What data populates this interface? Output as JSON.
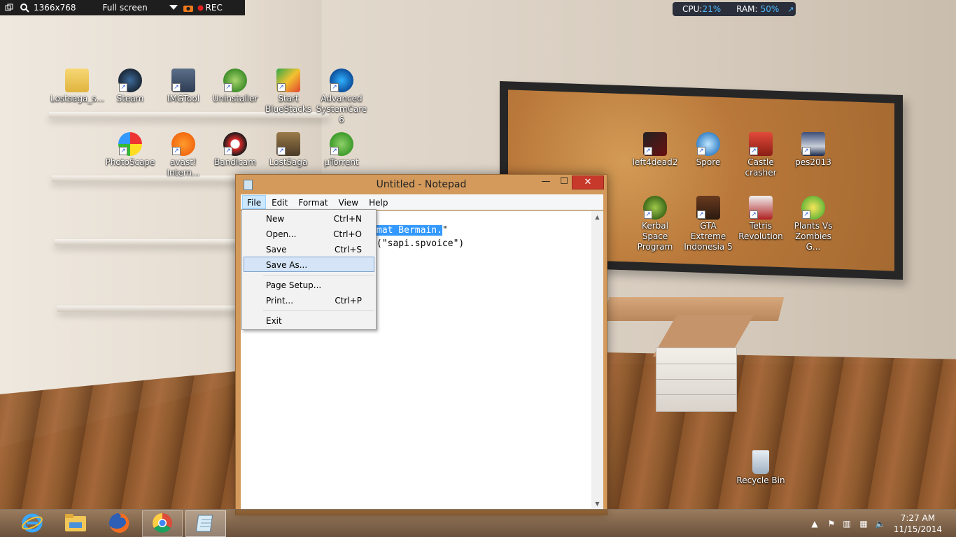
{
  "recorder": {
    "resolution": "1366x768",
    "mode": "Full screen",
    "rec_label": "REC"
  },
  "system_meter": {
    "cpu_label": "CPU:",
    "cpu_value": "21%",
    "ram_label": "RAM:",
    "ram_value": "50%"
  },
  "desktop_icons": [
    {
      "line1": "Lostsaga_s...",
      "line2": "",
      "icon": "folder-icon"
    },
    {
      "line1": "Steam",
      "line2": "",
      "icon": "steam-icon"
    },
    {
      "line1": "IMGTool",
      "line2": "",
      "icon": "imgtool-icon"
    },
    {
      "line1": "Uninstaller",
      "line2": "",
      "icon": "uninstaller-icon"
    },
    {
      "line1": "Start",
      "line2": "BlueStacks",
      "icon": "bluestacks-icon"
    },
    {
      "line1": "Advanced",
      "line2": "SystemCare 6",
      "icon": "systemcare-icon"
    },
    {
      "line1": "PhotoScape",
      "line2": "",
      "icon": "photoscape-icon"
    },
    {
      "line1": "avast!",
      "line2": "Intern...",
      "icon": "avast-icon"
    },
    {
      "line1": "Bandicam",
      "line2": "",
      "icon": "bandicam-icon"
    },
    {
      "line1": "LostSaga",
      "line2": "",
      "icon": "lostsaga-icon"
    },
    {
      "line1": "µTorrent",
      "line2": "",
      "icon": "utorrent-icon"
    },
    {
      "line1": "left4dead2",
      "line2": "",
      "icon": "left4dead2-icon"
    },
    {
      "line1": "Spore",
      "line2": "",
      "icon": "spore-icon"
    },
    {
      "line1": "Castle",
      "line2": "crasher",
      "icon": "castle-crasher-icon"
    },
    {
      "line1": "pes2013",
      "line2": "",
      "icon": "pes2013-icon"
    },
    {
      "line1": "Kerbal Space",
      "line2": "Program",
      "icon": "kerbal-icon"
    },
    {
      "line1": "GTA Extreme",
      "line2": "Indonesia 5",
      "icon": "gta-icon"
    },
    {
      "line1": "Tetris",
      "line2": "Revolution",
      "icon": "tetris-icon"
    },
    {
      "line1": "Plants Vs",
      "line2": "Zombies G...",
      "icon": "pvz-icon"
    },
    {
      "line1": "Recycle Bin",
      "line2": "",
      "icon": "recycle-bin-icon"
    }
  ],
  "notepad": {
    "title": "Untitled - Notepad",
    "menu": [
      "File",
      "Edit",
      "Format",
      "View",
      "Help"
    ],
    "active_menu": "File",
    "line1_selected": "mat Bermain.",
    "line1_rest": "\"",
    "line2": "(\"sapi.spvoice\")",
    "close_glyph": "✕",
    "min_glyph": "—",
    "max_glyph": "☐"
  },
  "file_menu": {
    "items": [
      {
        "label": "New",
        "shortcut": "Ctrl+N"
      },
      {
        "label": "Open...",
        "shortcut": "Ctrl+O"
      },
      {
        "label": "Save",
        "shortcut": "Ctrl+S"
      },
      {
        "label": "Save As...",
        "shortcut": ""
      },
      {
        "label": "Page Setup...",
        "shortcut": ""
      },
      {
        "label": "Print...",
        "shortcut": "Ctrl+P"
      },
      {
        "label": "Exit",
        "shortcut": ""
      }
    ],
    "highlighted": "Save As..."
  },
  "taskbar": {
    "apps": [
      "internet-explorer-icon",
      "file-explorer-icon",
      "firefox-icon",
      "chrome-icon",
      "notepad-icon"
    ],
    "time": "7:27 AM",
    "date": "11/15/2014"
  },
  "colors": {
    "selection": "#3399ff",
    "menu_hover": "#d5e5f7",
    "close_button": "#c7392b",
    "window_frame": "#d39a5c",
    "meter_value": "#4fb8ff"
  }
}
